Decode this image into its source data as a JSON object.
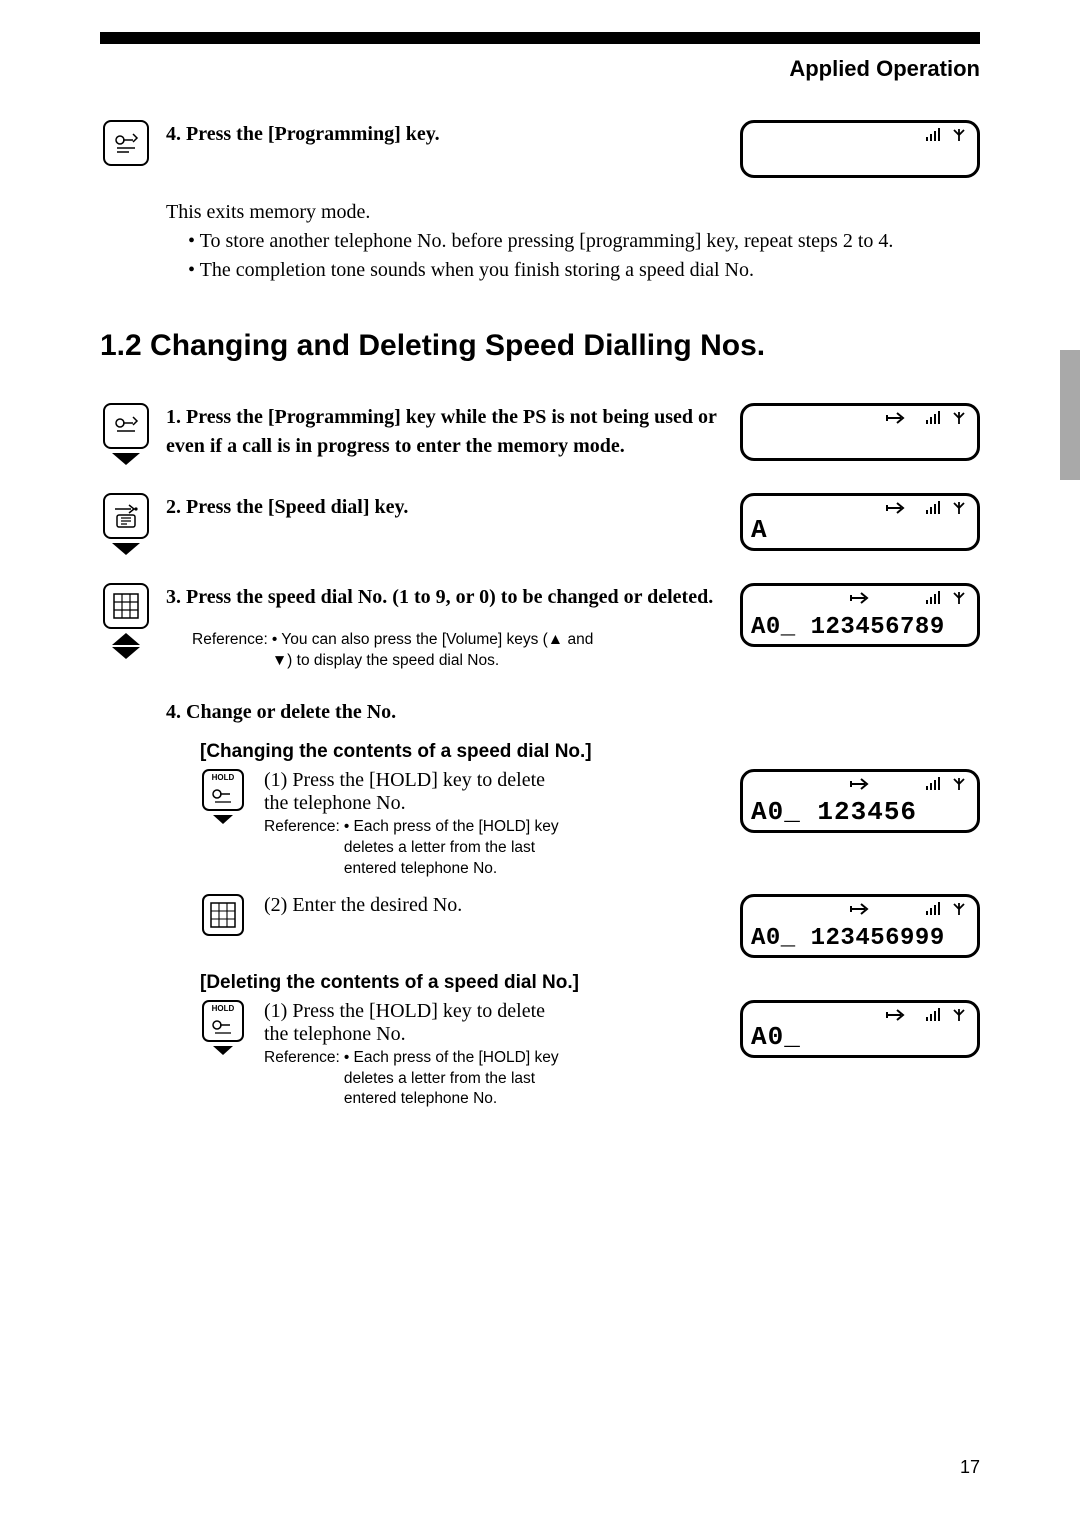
{
  "header": {
    "section": "Applied Operation"
  },
  "page_number": "17",
  "block1": {
    "step4": {
      "num": "4.",
      "text": "Press the [Programming] key."
    },
    "exit_line": "This exits memory mode.",
    "bullet1": "• To store another telephone No. before pressing [programming] key, repeat steps 2 to 4.",
    "bullet2": "• The completion tone sounds when you finish storing a speed dial No."
  },
  "section_heading": "1.2 Changing and Deleting Speed Dialling Nos.",
  "steps": {
    "s1": {
      "num": "1.",
      "text": "Press the [Programming] key while the PS is not being used or even if a call is in progress to enter the memory mode."
    },
    "s2": {
      "num": "2.",
      "text": "Press the [Speed dial] key."
    },
    "s3": {
      "num": "3.",
      "text": "Press the speed dial No. (1 to 9, or 0) to be changed or deleted."
    },
    "s3_ref_label": "Reference:",
    "s3_ref_text": "• You can also press the [Volume] keys (▲ and ▼) to display the speed dial Nos.",
    "s4": {
      "num": "4.",
      "text": "Change or delete the No."
    }
  },
  "changing": {
    "heading": "[Changing the contents of a speed dial No.]",
    "p1": "(1) Press the [HOLD] key to delete the telephone No.",
    "ref_label": "Reference:",
    "ref_text": "•   Each press of the [HOLD] key deletes a letter from the last entered telephone No.",
    "p2": "(2) Enter the desired No."
  },
  "deleting": {
    "heading": "[Deleting the contents of a speed dial No.]",
    "p1": "(1) Press the [HOLD] key to delete the telephone No.",
    "ref_label": "Reference:",
    "ref_text": "•   Each press of the [HOLD] key deletes a letter from the last entered telephone No."
  },
  "lcd": {
    "d2_text": "A",
    "d3_text": "A0_ 123456789",
    "d4_text": "A0_ 123456",
    "d5_text": "A0_ 123456999",
    "d6_text": "A0_"
  },
  "icons": {
    "hold_label": "HOLD"
  }
}
